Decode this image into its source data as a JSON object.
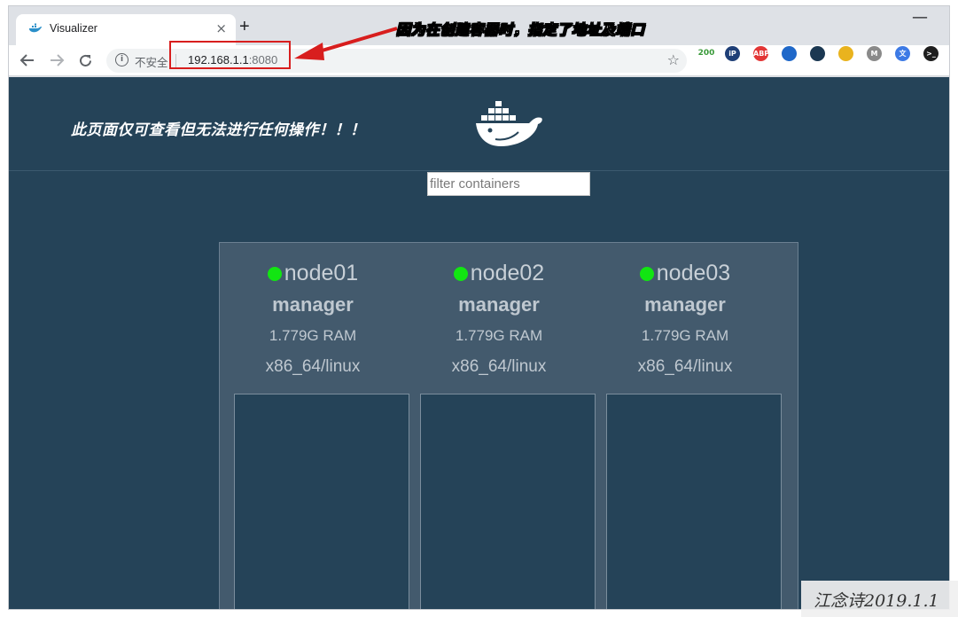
{
  "browser": {
    "tab_title": "Visualizer",
    "tab_close": "×",
    "new_tab": "+",
    "minimize": "—",
    "security_label": "不安全",
    "url_host": "192.168.1.1",
    "url_port": ":8080",
    "extensions": [
      {
        "name": "badge-200",
        "text": "200",
        "color": "#ffffff"
      },
      {
        "name": "ip-icon",
        "text": "iP",
        "color": "#1f3f77"
      },
      {
        "name": "adblock-icon",
        "text": "ABP",
        "color": "#e33636"
      },
      {
        "name": "firefox-icon",
        "text": "",
        "color": "#1f68c9"
      },
      {
        "name": "wifi-icon",
        "text": "",
        "color": "#1b3852"
      },
      {
        "name": "chrome-icon",
        "text": "",
        "color": "#e9b31e"
      },
      {
        "name": "m-icon",
        "text": "M",
        "color": "#8a8a8a"
      },
      {
        "name": "translate-icon",
        "text": "文",
        "color": "#3d7ae5"
      },
      {
        "name": "terminal-icon",
        "text": ">_",
        "color": "#1e1e1e"
      }
    ]
  },
  "annotation": "因为在创建容器时，指定了地址及端口",
  "page": {
    "note": "此页面仅可查看但无法进行任何操作！！！",
    "filter_placeholder": "filter containers"
  },
  "nodes": [
    {
      "name": "node01",
      "role": "manager",
      "ram": "1.779G RAM",
      "os": "x86_64/linux",
      "status_color": "#12e512"
    },
    {
      "name": "node02",
      "role": "manager",
      "ram": "1.779G RAM",
      "os": "x86_64/linux",
      "status_color": "#12e512"
    },
    {
      "name": "node03",
      "role": "manager",
      "ram": "1.779G RAM",
      "os": "x86_64/linux",
      "status_color": "#12e512"
    }
  ],
  "watermark": "江念诗2019.1.1"
}
